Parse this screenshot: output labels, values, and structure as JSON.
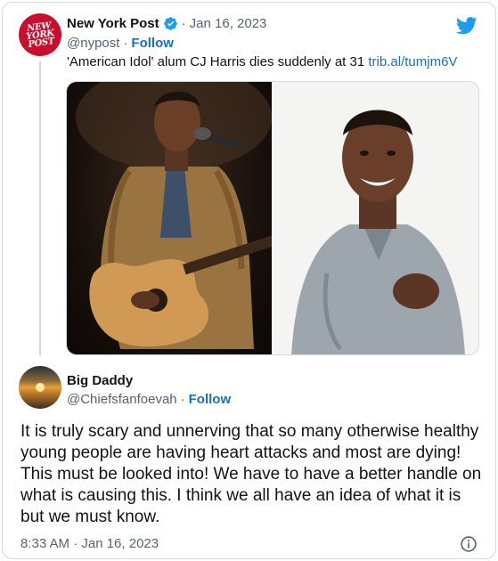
{
  "quoted_tweet": {
    "avatar_text": [
      "NEW",
      "YORK",
      "POST"
    ],
    "author_name": "New York Post",
    "separator": "·",
    "date": "Jan 16, 2023",
    "handle": "@nypost",
    "follow_label": "Follow",
    "headline": "'American Idol' alum CJ Harris dies suddenly at 31",
    "link_text": "trib.al/tumjm6V"
  },
  "reply_tweet": {
    "author_name": "Big Daddy",
    "handle": "@Chiefsfanfoevah",
    "separator": "·",
    "follow_label": "Follow",
    "body": "It is truly scary and unnerving that so many otherwise healthy young people are having heart attacks and most are dying! This must be looked into! We have to have a better handle on what is causing this. I think we all have an idea of what it is but we must know.",
    "timestamp": "8:33 AM · Jan 16, 2023"
  },
  "icons": {
    "brand": "twitter-bird-icon",
    "verified": "verified-badge-icon",
    "info": "info-icon"
  },
  "colors": {
    "link": "#1d6fb8",
    "twitter_blue": "#1d9bf0",
    "nypost_red": "#c8102e",
    "muted": "#536471"
  }
}
